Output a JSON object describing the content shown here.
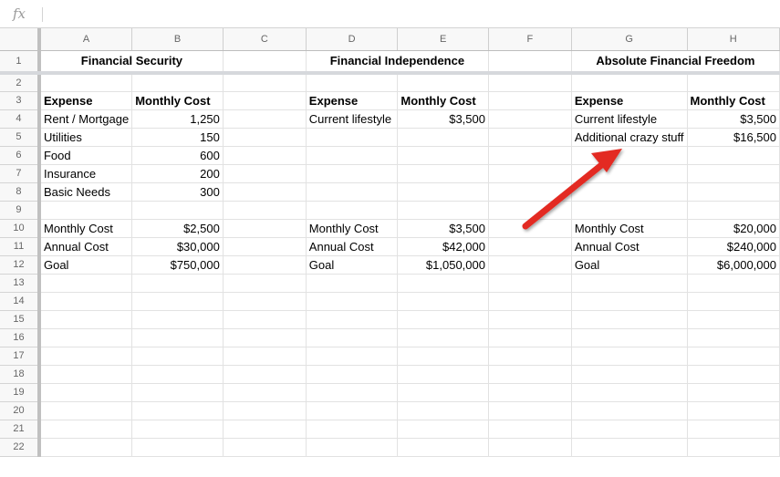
{
  "formula_bar": {
    "fx_label": "fx",
    "value": ""
  },
  "columns": [
    "A",
    "B",
    "C",
    "D",
    "E",
    "F",
    "G",
    "H"
  ],
  "rows": [
    {
      "n": "1",
      "cells": [
        "",
        "Financial Security",
        "",
        "",
        "Financial Independence",
        "",
        "",
        "Absolute Financial Freedom"
      ]
    },
    {
      "n": "2",
      "cells": [
        "",
        "",
        "",
        "",
        "",
        "",
        "",
        ""
      ]
    },
    {
      "n": "3",
      "cells": [
        "Expense",
        "Monthly Cost",
        "",
        "Expense",
        "Monthly Cost",
        "",
        "Expense",
        "Monthly Cost"
      ]
    },
    {
      "n": "4",
      "cells": [
        "Rent / Mortgage",
        "1,250",
        "",
        "Current lifestyle",
        "$3,500",
        "",
        "Current lifestyle",
        "$3,500"
      ]
    },
    {
      "n": "5",
      "cells": [
        "Utilities",
        "150",
        "",
        "",
        "",
        "",
        "Additional crazy stuff",
        "$16,500"
      ]
    },
    {
      "n": "6",
      "cells": [
        "Food",
        "600",
        "",
        "",
        "",
        "",
        "",
        ""
      ]
    },
    {
      "n": "7",
      "cells": [
        "Insurance",
        "200",
        "",
        "",
        "",
        "",
        "",
        ""
      ]
    },
    {
      "n": "8",
      "cells": [
        "Basic Needs",
        "300",
        "",
        "",
        "",
        "",
        "",
        ""
      ]
    },
    {
      "n": "9",
      "cells": [
        "",
        "",
        "",
        "",
        "",
        "",
        "",
        ""
      ]
    },
    {
      "n": "10",
      "cells": [
        "Monthly Cost",
        "$2,500",
        "",
        "Monthly Cost",
        "$3,500",
        "",
        "Monthly Cost",
        "$20,000"
      ]
    },
    {
      "n": "11",
      "cells": [
        "Annual Cost",
        "$30,000",
        "",
        "Annual Cost",
        "$42,000",
        "",
        "Annual Cost",
        "$240,000"
      ]
    },
    {
      "n": "12",
      "cells": [
        "Goal",
        "$750,000",
        "",
        "Goal",
        "$1,050,000",
        "",
        "Goal",
        "$6,000,000"
      ]
    },
    {
      "n": "13",
      "cells": [
        "",
        "",
        "",
        "",
        "",
        "",
        "",
        ""
      ]
    },
    {
      "n": "14",
      "cells": [
        "",
        "",
        "",
        "",
        "",
        "",
        "",
        ""
      ]
    },
    {
      "n": "15",
      "cells": [
        "",
        "",
        "",
        "",
        "",
        "",
        "",
        ""
      ]
    },
    {
      "n": "16",
      "cells": [
        "",
        "",
        "",
        "",
        "",
        "",
        "",
        ""
      ]
    },
    {
      "n": "17",
      "cells": [
        "",
        "",
        "",
        "",
        "",
        "",
        "",
        ""
      ]
    },
    {
      "n": "18",
      "cells": [
        "",
        "",
        "",
        "",
        "",
        "",
        "",
        ""
      ]
    },
    {
      "n": "19",
      "cells": [
        "",
        "",
        "",
        "",
        "",
        "",
        "",
        ""
      ]
    },
    {
      "n": "20",
      "cells": [
        "",
        "",
        "",
        "",
        "",
        "",
        "",
        ""
      ]
    },
    {
      "n": "21",
      "cells": [
        "",
        "",
        "",
        "",
        "",
        "",
        "",
        ""
      ]
    },
    {
      "n": "22",
      "cells": [
        "",
        "",
        "",
        "",
        "",
        "",
        "",
        ""
      ]
    }
  ],
  "annotation": {
    "arrow_color": "#e32a22"
  }
}
